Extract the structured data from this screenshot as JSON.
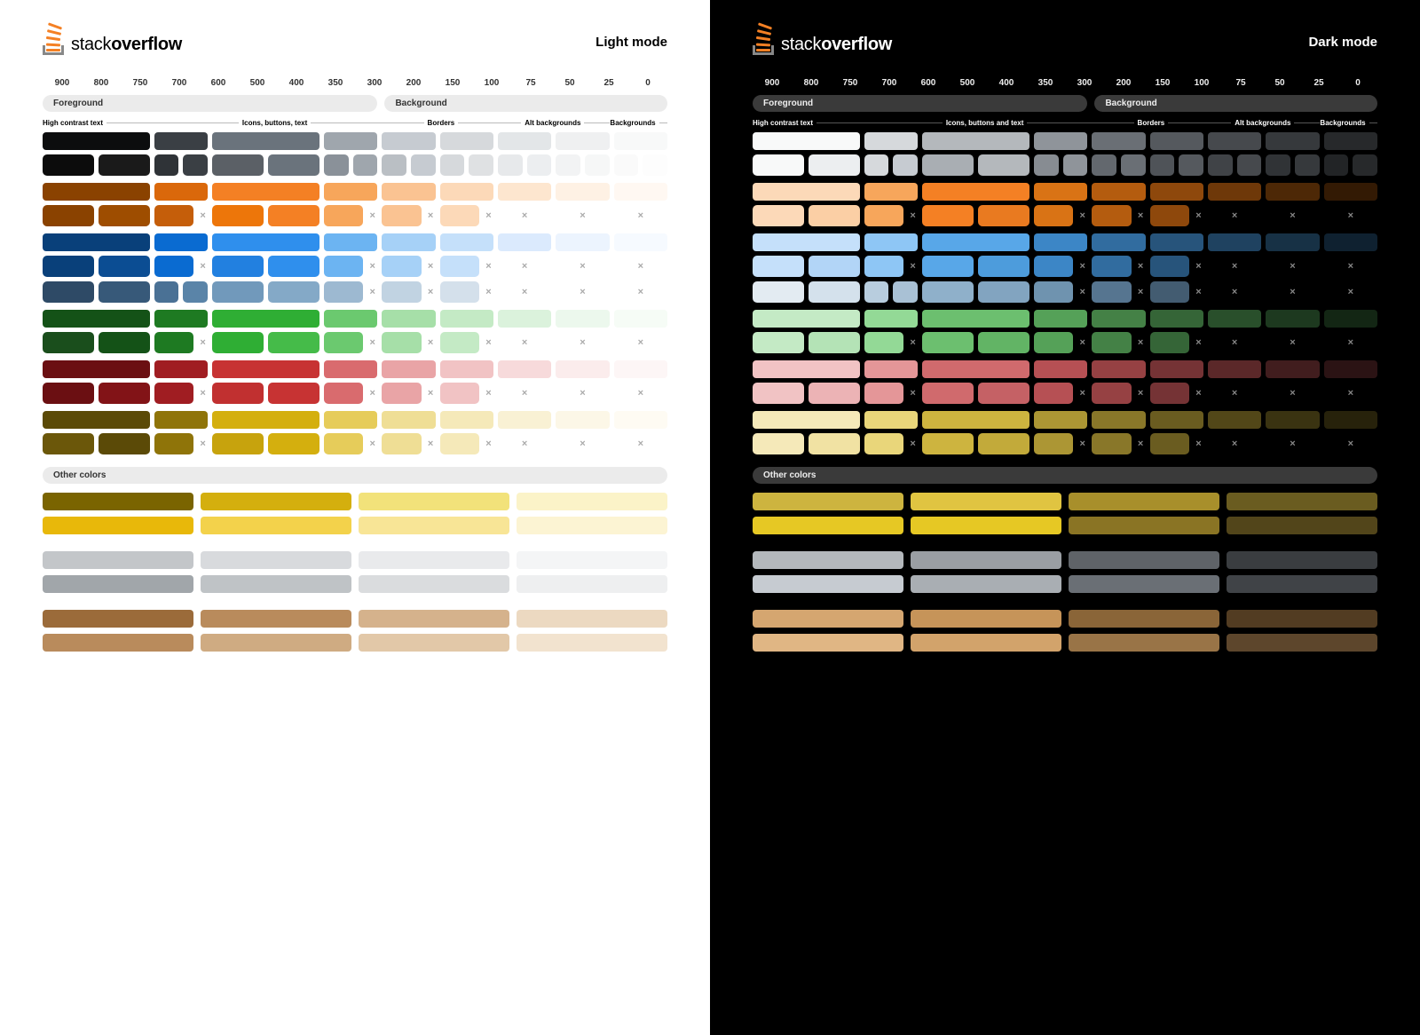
{
  "brand": {
    "name_a": "stack",
    "name_b": "overflow"
  },
  "modes": {
    "light": "Light mode",
    "dark": "Dark mode"
  },
  "steps": [
    "900",
    "800",
    "750",
    "700",
    "600",
    "500",
    "400",
    "350",
    "300",
    "200",
    "150",
    "100",
    "75",
    "50",
    "25",
    "0"
  ],
  "section": {
    "fg": "Foreground",
    "bg": "Background",
    "other": "Other colors"
  },
  "sub": {
    "a": "High contrast text",
    "b_light": "Icons, buttons, text",
    "b_dark": "Icons, buttons and text",
    "c": "Borders",
    "d": "Alt backgrounds",
    "e": "Backgrounds"
  },
  "x": "×",
  "palette_light": {
    "gray": [
      "#0c0d0e",
      "#3a3f44",
      "#6a737c",
      "#9fa6ad",
      "#c6cbd1",
      "#d6d9dc",
      "#e3e6e8",
      "#eff0f1",
      "#f8f9f9"
    ],
    "orange": [
      "#8a4200",
      "#da680b",
      "#f48024",
      "#f7a65b",
      "#fac392",
      "#fcd9b8",
      "#fde6cf",
      "#fef1e4",
      "#fff8f2"
    ],
    "blue": [
      "#09407a",
      "#0a6bd1",
      "#2f8fed",
      "#6cb4f2",
      "#a6d1f7",
      "#c5e0fa",
      "#dbeafd",
      "#ecf4fe",
      "#f6faff"
    ],
    "powder": [
      "#2e4a66",
      "#4a7195",
      "#7199bb",
      "#9db9d1",
      "#c1d3e2",
      "#d4e0eb",
      "#e3ebf2",
      "#eef3f7",
      "#f7fafc"
    ],
    "green": [
      "#145217",
      "#1e7a22",
      "#2fae34",
      "#6bc96f",
      "#a6dfa8",
      "#c4eac5",
      "#dbf2dc",
      "#ecf8ed",
      "#f6fcf6"
    ],
    "red": [
      "#6b0f12",
      "#a01d22",
      "#c73333",
      "#d96b6e",
      "#e9a4a6",
      "#f1c3c4",
      "#f7dadb",
      "#fbecec",
      "#fdf6f6"
    ],
    "yellow": [
      "#5b4a07",
      "#8f7409",
      "#d4af0e",
      "#e6cc5a",
      "#efde95",
      "#f5e9b9",
      "#f9f1d4",
      "#fcf7e7",
      "#fefbf3"
    ]
  },
  "palette_dark": {
    "gray": [
      "#f8f9f9",
      "#d6d9dc",
      "#b4b8bc",
      "#8f949a",
      "#6a6f75",
      "#55595e",
      "#46494d",
      "#36393c",
      "#27292b"
    ],
    "orange": [
      "#fcd9b8",
      "#f7a65b",
      "#f48024",
      "#d97315",
      "#b45c0f",
      "#8e480c",
      "#6e3809",
      "#4d2806",
      "#331a04"
    ],
    "blue": [
      "#c5e0fa",
      "#8ec6f5",
      "#58a7e8",
      "#3c86c6",
      "#316c9f",
      "#27547b",
      "#1f4260",
      "#173145",
      "#0f2130"
    ],
    "powder": [
      "#e3ebf2",
      "#b8cdde",
      "#8fb0ca",
      "#6f93af",
      "#567590",
      "#435c71",
      "#344858",
      "#263540",
      "#19232b"
    ],
    "green": [
      "#c4eac5",
      "#93d996",
      "#6cbf6f",
      "#55a158",
      "#448146",
      "#356537",
      "#294f2b",
      "#1d391f",
      "#132614"
    ],
    "red": [
      "#f1c3c4",
      "#e49698",
      "#d06a6d",
      "#b65054",
      "#964143",
      "#753335",
      "#5b2829",
      "#411d1e",
      "#2b1314"
    ],
    "yellow": [
      "#f5e9b9",
      "#e9d67a",
      "#cdb43f",
      "#ac9634",
      "#897729",
      "#6a5c20",
      "#524718",
      "#3a3311",
      "#27220b"
    ]
  },
  "squares_light": {
    "gray": [
      [
        "#0c0c0c",
        "#1a1a1a"
      ],
      [
        "#2f3337",
        "#3a3f44"
      ],
      [
        "#5b6066",
        "#6a737c"
      ],
      [
        "#8a9199",
        "#9fa6ad"
      ],
      [
        "#babfc4",
        "#c6cbd1"
      ],
      [
        "#d6d9dc",
        "#dfe1e3"
      ],
      [
        "#e7e9eb",
        "#eceef0"
      ],
      [
        "#f2f3f4",
        "#f6f7f7"
      ],
      [
        "#fafafa",
        "#fdfdfd"
      ]
    ],
    "orange": [
      [
        "#8a4200",
        "#9e4d00"
      ],
      [
        "#c55e0a",
        ""
      ],
      [
        "#ed760a",
        "#f48024"
      ],
      [
        "#f7a65b",
        ""
      ],
      [
        "#fac392",
        ""
      ],
      [
        "#fcd9b8",
        ""
      ],
      [
        "",
        ""
      ],
      [
        "",
        ""
      ],
      [
        "",
        ""
      ]
    ],
    "blue": [
      [
        "#09407a",
        "#0b4d93"
      ],
      [
        "#0a6bd1",
        ""
      ],
      [
        "#2280e0",
        "#2f8fed"
      ],
      [
        "#6cb4f2",
        ""
      ],
      [
        "#a6d1f7",
        ""
      ],
      [
        "#c5e0fa",
        ""
      ],
      [
        "",
        ""
      ],
      [
        "",
        ""
      ],
      [
        "",
        ""
      ]
    ],
    "powder": [
      [
        "#2e4a66",
        "#375979"
      ],
      [
        "#4a7195",
        "#5a84a8"
      ],
      [
        "#7199bb",
        "#84a9c7"
      ],
      [
        "#9db9d1",
        ""
      ],
      [
        "#c1d3e2",
        ""
      ],
      [
        "#d4e0eb",
        ""
      ],
      [
        "",
        ""
      ],
      [
        "",
        ""
      ],
      [
        "",
        ""
      ]
    ],
    "green": [
      [
        "#1a4e1c",
        "#145217"
      ],
      [
        "#1e7a22",
        ""
      ],
      [
        "#2fae34",
        "#45bb49"
      ],
      [
        "#6bc96f",
        ""
      ],
      [
        "#a6dfa8",
        ""
      ],
      [
        "#c4eac5",
        ""
      ],
      [
        "",
        ""
      ],
      [
        "",
        ""
      ],
      [
        "",
        ""
      ]
    ],
    "red": [
      [
        "#6b0f12",
        "#821317"
      ],
      [
        "#a01d22",
        ""
      ],
      [
        "#c13030",
        "#c73333"
      ],
      [
        "#d96b6e",
        ""
      ],
      [
        "#e9a4a6",
        ""
      ],
      [
        "#f1c3c4",
        ""
      ],
      [
        "",
        ""
      ],
      [
        "",
        ""
      ],
      [
        "",
        ""
      ]
    ],
    "yellow": [
      [
        "#6b570a",
        "#5b4a07"
      ],
      [
        "#8f7409",
        ""
      ],
      [
        "#c7a30d",
        "#d4af0e"
      ],
      [
        "#e6cc5a",
        ""
      ],
      [
        "#efde95",
        ""
      ],
      [
        "#f5e9b9",
        ""
      ],
      [
        "",
        ""
      ],
      [
        "",
        ""
      ],
      [
        "",
        ""
      ]
    ]
  },
  "squares_dark": {
    "gray": [
      [
        "#f8f9f9",
        "#eceef0"
      ],
      [
        "#d6d9dc",
        "#c6cbd1"
      ],
      [
        "#a9aeb3",
        "#b4b8bc"
      ],
      [
        "#878c92",
        "#8f949a"
      ],
      [
        "#63686e",
        "#6a6f75"
      ],
      [
        "#4f5358",
        "#55595e"
      ],
      [
        "#404347",
        "#46494d"
      ],
      [
        "#303336",
        "#36393c"
      ],
      [
        "#222426",
        "#27292b"
      ]
    ],
    "orange": [
      [
        "#fcd9b8",
        "#fbcfa5"
      ],
      [
        "#f7a65b",
        ""
      ],
      [
        "#f48024",
        "#e97a20"
      ],
      [
        "#d97315",
        ""
      ],
      [
        "#b45c0f",
        ""
      ],
      [
        "#8e480c",
        ""
      ],
      [
        "",
        ""
      ],
      [
        "",
        ""
      ],
      [
        "",
        ""
      ]
    ],
    "blue": [
      [
        "#c5e0fa",
        "#b2d5f7"
      ],
      [
        "#8ec6f5",
        ""
      ],
      [
        "#58a7e8",
        "#4d9cdc"
      ],
      [
        "#3c86c6",
        ""
      ],
      [
        "#316c9f",
        ""
      ],
      [
        "#27547b",
        ""
      ],
      [
        "",
        ""
      ],
      [
        "",
        ""
      ],
      [
        "",
        ""
      ]
    ],
    "powder": [
      [
        "#e3ebf2",
        "#d4e1ec"
      ],
      [
        "#b8cdde",
        "#a9c1d5"
      ],
      [
        "#8fb0ca",
        "#82a4c0"
      ],
      [
        "#6f93af",
        ""
      ],
      [
        "#567590",
        ""
      ],
      [
        "#435c71",
        ""
      ],
      [
        "",
        ""
      ],
      [
        "",
        ""
      ],
      [
        "",
        ""
      ]
    ],
    "green": [
      [
        "#c4eac5",
        "#b4e3b6"
      ],
      [
        "#93d996",
        ""
      ],
      [
        "#6cbf6f",
        "#62b465"
      ],
      [
        "#55a158",
        ""
      ],
      [
        "#448146",
        ""
      ],
      [
        "#356537",
        ""
      ],
      [
        "",
        ""
      ],
      [
        "",
        ""
      ],
      [
        "",
        ""
      ]
    ],
    "red": [
      [
        "#f1c3c4",
        "#ecb3b5"
      ],
      [
        "#e49698",
        ""
      ],
      [
        "#d06a6d",
        "#c56165"
      ],
      [
        "#b65054",
        ""
      ],
      [
        "#964143",
        ""
      ],
      [
        "#753335",
        ""
      ],
      [
        "",
        ""
      ],
      [
        "",
        ""
      ],
      [
        "",
        ""
      ]
    ],
    "yellow": [
      [
        "#f5e9b9",
        "#f1e2a3"
      ],
      [
        "#e9d67a",
        ""
      ],
      [
        "#cdb43f",
        "#c2aa3a"
      ],
      [
        "#ac9634",
        ""
      ],
      [
        "#897729",
        ""
      ],
      [
        "#6a5c20",
        ""
      ],
      [
        "",
        ""
      ],
      [
        "",
        ""
      ],
      [
        "",
        ""
      ]
    ]
  },
  "other_light": [
    [
      "#7a6400",
      "#d4af0e",
      "#f2e27a",
      "#fbf3c8"
    ],
    [
      "#e8b80a",
      "#f3d24b",
      "#f8e596",
      "#fcf4d3"
    ],
    [
      "#c3c6c9",
      "#d8dadd",
      "#e9eaec",
      "#f4f5f6"
    ],
    [
      "#a1a6aa",
      "#bfc3c6",
      "#dadcde",
      "#eeeff0"
    ],
    [
      "#9b6b3a",
      "#b98b5c",
      "#d5b28c",
      "#ecd9c1"
    ],
    [
      "#b98b5c",
      "#cfab82",
      "#e2c8a8",
      "#f2e3cf"
    ]
  ],
  "other_dark": [
    [
      "#cdb43f",
      "#e0c441",
      "#a88f2b",
      "#6a5c20"
    ],
    [
      "#e6c824",
      "#e6c824",
      "#8a7424",
      "#52451a"
    ],
    [
      "#b4b8bc",
      "#9a9ea3",
      "#5f6368",
      "#3a3d40"
    ],
    [
      "#c6cbd1",
      "#a9aeb3",
      "#6a6f75",
      "#404347"
    ],
    [
      "#d5a670",
      "#c69459",
      "#8a6538",
      "#523c22"
    ],
    [
      "#e0b684",
      "#d2a36b",
      "#997447",
      "#5d462c"
    ]
  ]
}
